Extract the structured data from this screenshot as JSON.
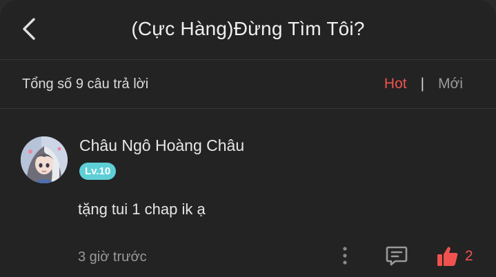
{
  "header": {
    "title": "(Cực Hàng)Đừng Tìm Tôi?",
    "back_icon": "chevron-left-icon"
  },
  "summary": {
    "count_text": "Tổng số 9 câu trả lời",
    "sort_hot": "Hot",
    "sort_separator": "|",
    "sort_new": "Mới",
    "active_sort": "Hot"
  },
  "comment": {
    "username": "Châu Ngô Hoàng Châu",
    "level": "Lv.10",
    "text": "tặng tui 1 chap ik ạ",
    "time": "3 giờ trước",
    "like_count": "2",
    "icons": {
      "more": "more-vertical-icon",
      "reply": "comment-icon",
      "like": "thumbs-up-icon"
    }
  },
  "colors": {
    "background": "#232323",
    "accent": "#f0524f",
    "level_badge": "#5ecfd6",
    "muted_text": "#9a9a9a"
  }
}
